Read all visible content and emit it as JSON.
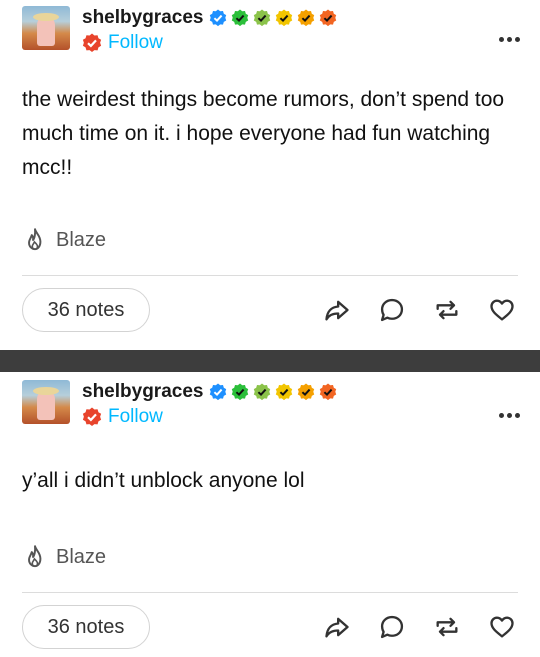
{
  "posts": [
    {
      "username": "shelbygraces",
      "follow_label": "Follow",
      "content": "the weirdest things become rumors, don’t spend too much time on it. i hope everyone had fun watching mcc!!",
      "blaze_label": "Blaze",
      "notes_label": "36 notes"
    },
    {
      "username": "shelbygraces",
      "follow_label": "Follow",
      "content": "y’all i didn’t unblock anyone lol",
      "blaze_label": "Blaze",
      "notes_label": "36 notes"
    }
  ],
  "badge_colors": [
    "#1e90ff",
    "#2bbf3a",
    "#8bc34a",
    "#f2c500",
    "#f5a000",
    "#f26522"
  ],
  "icons": {
    "badges": "checkmark-badge-icon",
    "follow": "follow-badge-icon",
    "more": "more-dots-icon",
    "blaze": "flame-icon",
    "share": "share-icon",
    "reply": "reply-icon",
    "reblog": "reblog-icon",
    "like": "heart-icon"
  }
}
